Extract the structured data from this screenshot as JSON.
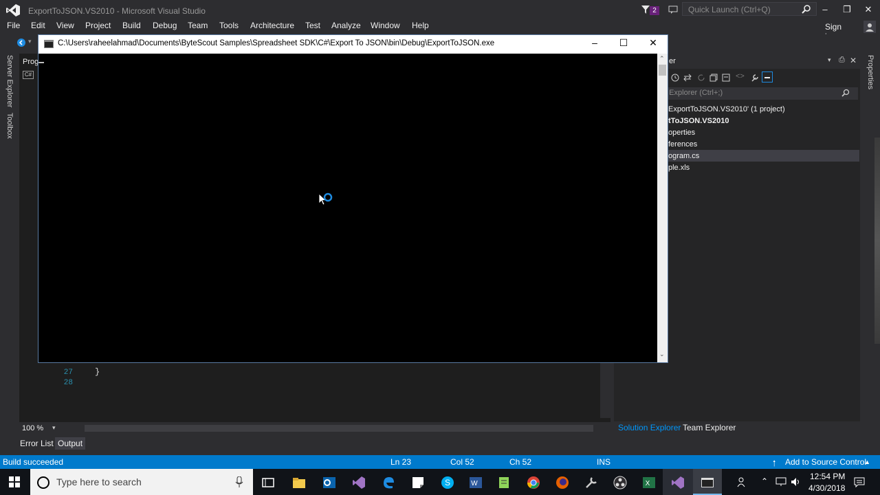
{
  "vs": {
    "title": "ExportToJSON.VS2010 - Microsoft Visual Studio",
    "notification_count": "2",
    "quick_launch_placeholder": "Quick Launch (Ctrl+Q)",
    "signin": "Sign in",
    "menu": [
      "File",
      "Edit",
      "View",
      "Project",
      "Build",
      "Debug",
      "Team",
      "Tools",
      "Architecture",
      "Test",
      "Analyze",
      "Window",
      "Help"
    ],
    "left_tabs": [
      "Server Explorer",
      "Toolbox"
    ],
    "right_tabs": [
      "Properties"
    ],
    "editor": {
      "tab_fragment": "Prog",
      "line_numbers": [
        "27",
        "28"
      ],
      "brace": "}",
      "zoom": "100 %"
    },
    "bottom_tabs": [
      "Error List",
      "Output"
    ],
    "solution_explorer": {
      "header_fragment": "er",
      "search_placeholder": "n Explorer (Ctrl+;)",
      "items": [
        "ExportToJSON.VS2010' (1 project)",
        "tToJSON.VS2010",
        "operties",
        "ferences",
        "ogram.cs",
        "ple.xls"
      ],
      "tabs": [
        "Solution Explorer",
        "Team Explorer"
      ]
    },
    "status": {
      "message": "Build succeeded",
      "ln": "Ln 23",
      "col": "Col 52",
      "ch": "Ch 52",
      "mode": "INS",
      "source_control": "Add to Source Control"
    }
  },
  "console": {
    "title": "C:\\Users\\raheelahmad\\Documents\\ByteScout Samples\\Spreadsheet SDK\\C#\\Export To JSON\\bin\\Debug\\ExportToJSON.exe"
  },
  "taskbar": {
    "search_placeholder": "Type here to search",
    "time": "12:54 PM",
    "date": "4/30/2018",
    "icons": [
      "task-view-icon",
      "file-explorer-icon",
      "outlook-icon",
      "visual-studio-icon",
      "edge-icon",
      "sticky-icon",
      "skype-icon",
      "word-icon",
      "notepad-plus-icon",
      "chrome-icon",
      "firefox-icon",
      "tools-icon",
      "obs-icon",
      "excel-icon",
      "visual-studio-2-icon",
      "console-app-icon"
    ]
  },
  "colors": {
    "vs_bg": "#2d2d30",
    "editor_bg": "#1e1e1e",
    "status_blue": "#007acc",
    "console_bg": "#000000",
    "taskbar_bg": "#101318"
  }
}
